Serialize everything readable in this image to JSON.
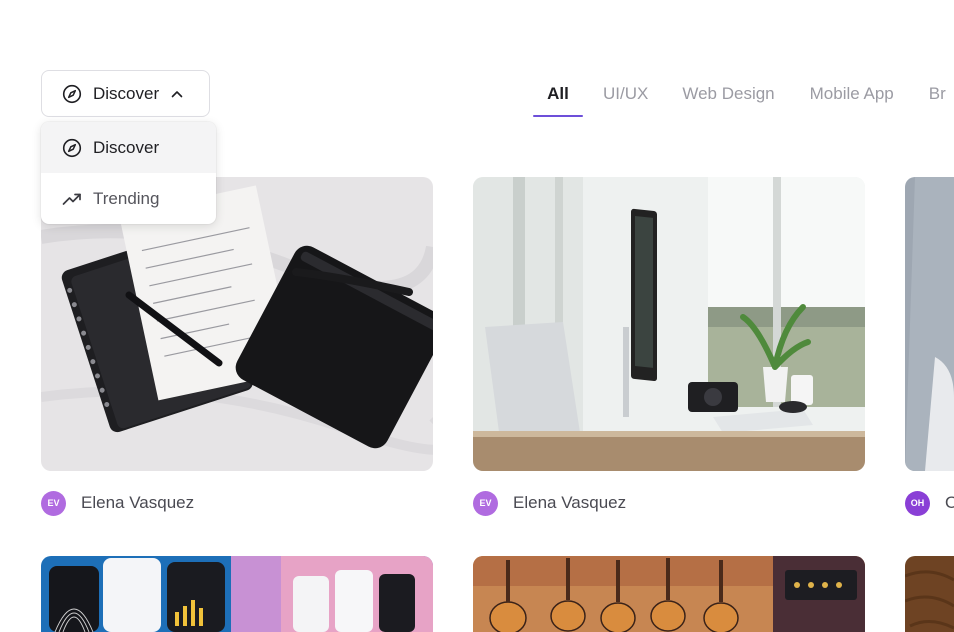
{
  "filter": {
    "selected_label": "Discover",
    "selected_icon": "compass-icon",
    "options": [
      {
        "label": "Discover",
        "icon": "compass-icon",
        "active": true
      },
      {
        "label": "Trending",
        "icon": "trending-up-icon",
        "active": false
      }
    ]
  },
  "tabs": [
    {
      "label": "All",
      "active": true
    },
    {
      "label": "UI/UX",
      "active": false
    },
    {
      "label": "Web Design",
      "active": false
    },
    {
      "label": "Mobile App",
      "active": false
    },
    {
      "label": "Br",
      "active": false
    }
  ],
  "cards": [
    {
      "author": "Elena Vasquez",
      "initials": "EV",
      "image": "notebook-pen-pouch-photo"
    },
    {
      "author": "Elena Vasquez",
      "initials": "EV",
      "image": "laptop-monitor-desk-photo"
    },
    {
      "author": "O",
      "initials": "OH",
      "image": "portrait-photo"
    },
    {
      "author": "",
      "initials": "",
      "image": "finance-app-mockup-photo"
    },
    {
      "author": "",
      "initials": "",
      "image": "guitars-wall-photo"
    },
    {
      "author": "",
      "initials": "",
      "image": "wood-texture-photo"
    }
  ],
  "colors": {
    "accent": "#6d4fd9",
    "avatar": "#b06be0",
    "avatar_dark": "#8a3fd6",
    "muted_text": "#9b9ba3"
  }
}
